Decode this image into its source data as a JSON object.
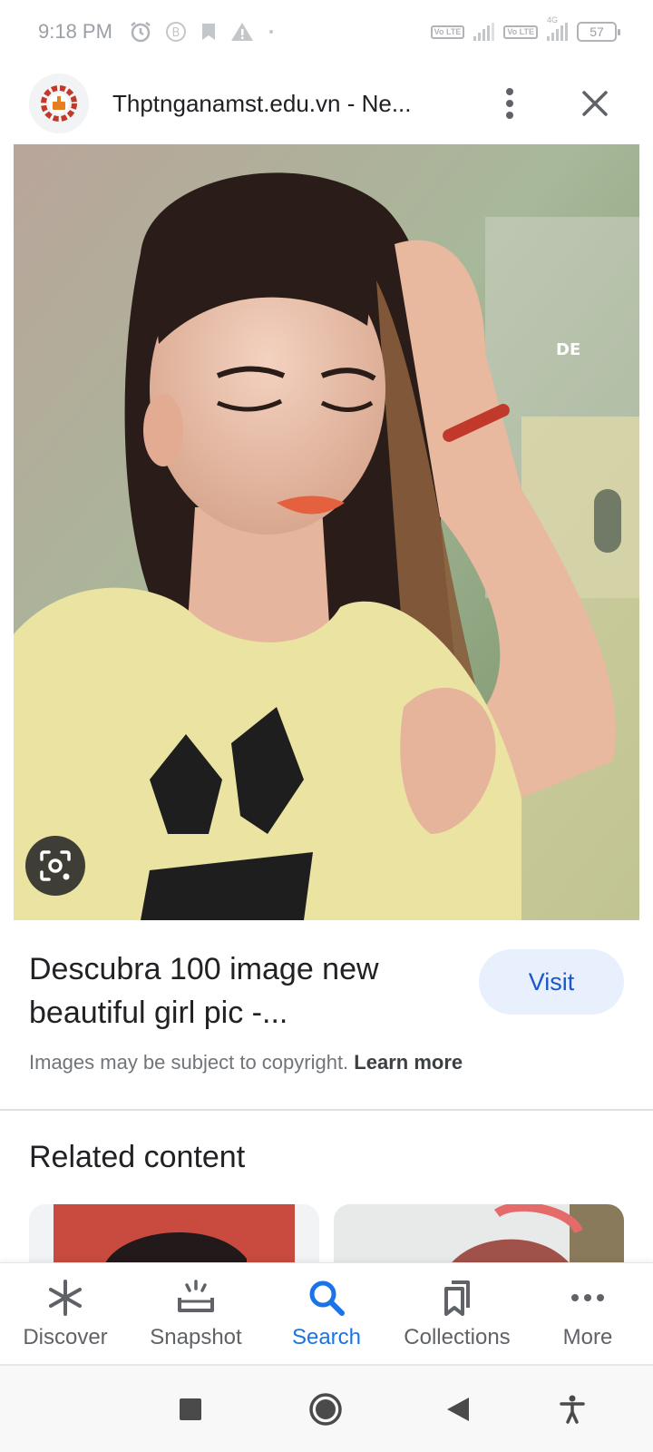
{
  "status_bar": {
    "time": "9:18 PM",
    "volte1": "Vo LTE",
    "volte2": "Vo LTE",
    "network": "4G",
    "battery": "57",
    "icons": [
      "alarm-icon",
      "bitcoin-icon",
      "bookmark-icon",
      "warning-icon",
      "dot-icon",
      "volte-icon",
      "signal-icon",
      "battery-icon"
    ]
  },
  "header": {
    "site_title": "Thptnganamst.edu.vn - Ne...",
    "icons": [
      "site-logo-icon",
      "more-vert-icon",
      "close-icon"
    ]
  },
  "image": {
    "watermark": "DE",
    "lens_icon": "lens-icon"
  },
  "result": {
    "title": "Descubra 100 image new beautiful girl pic -...",
    "visit_label": "Visit",
    "copyright_text": "Images may be subject to copyright.",
    "learn_more": "Learn more"
  },
  "related": {
    "heading": "Related content"
  },
  "bottom_nav": {
    "items": [
      {
        "label": "Discover",
        "icon": "asterisk-icon",
        "active": false
      },
      {
        "label": "Snapshot",
        "icon": "snapshot-icon",
        "active": false
      },
      {
        "label": "Search",
        "icon": "search-icon",
        "active": true
      },
      {
        "label": "Collections",
        "icon": "bookmarks-icon",
        "active": false
      },
      {
        "label": "More",
        "icon": "more-horiz-icon",
        "active": false
      }
    ]
  },
  "system_nav": {
    "icons": [
      "square-icon",
      "home-circle-icon",
      "back-triangle-icon",
      "accessibility-icon"
    ]
  },
  "colors": {
    "accent": "#1a73e8",
    "visit_bg": "#e8f0fe",
    "visit_text": "#1a57c9"
  }
}
